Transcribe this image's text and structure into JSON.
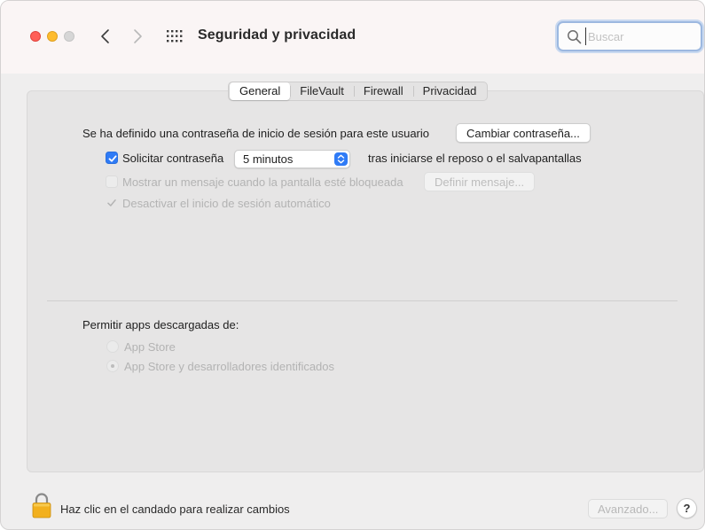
{
  "window": {
    "title": "Seguridad y privacidad",
    "search_placeholder": "Buscar"
  },
  "tabs": [
    {
      "label": "General",
      "active": true
    },
    {
      "label": "FileVault",
      "active": false
    },
    {
      "label": "Firewall",
      "active": false
    },
    {
      "label": "Privacidad",
      "active": false
    }
  ],
  "general": {
    "password_set_text": "Se ha definido una contraseña de inicio de sesión para este usuario",
    "change_password_button": "Cambiar contraseña...",
    "require_password": {
      "checked": true,
      "label": "Solicitar contraseña",
      "delay_value": "5 minutos",
      "suffix": "tras iniciarse el reposo o el salvapantallas"
    },
    "show_message": {
      "checked": false,
      "enabled": false,
      "label": "Mostrar un mensaje cuando la pantalla esté bloqueada",
      "button": "Definir mensaje..."
    },
    "disable_auto_login": {
      "checked": true,
      "enabled": false,
      "label": "Desactivar el inicio de sesión automático"
    },
    "allow_apps": {
      "title": "Permitir apps descargadas de:",
      "options": [
        {
          "label": "App Store",
          "selected": false
        },
        {
          "label": "App Store y desarrolladores identificados",
          "selected": true
        }
      ]
    }
  },
  "footer": {
    "lock_text": "Haz clic en el candado para realizar cambios",
    "advanced_button": "Avanzado...",
    "help_button": "?"
  },
  "colors": {
    "accent": "#2f7bf6",
    "traffic_close": "#ff5f57",
    "traffic_minimize": "#febc2e",
    "lock": "#f2b01e"
  }
}
